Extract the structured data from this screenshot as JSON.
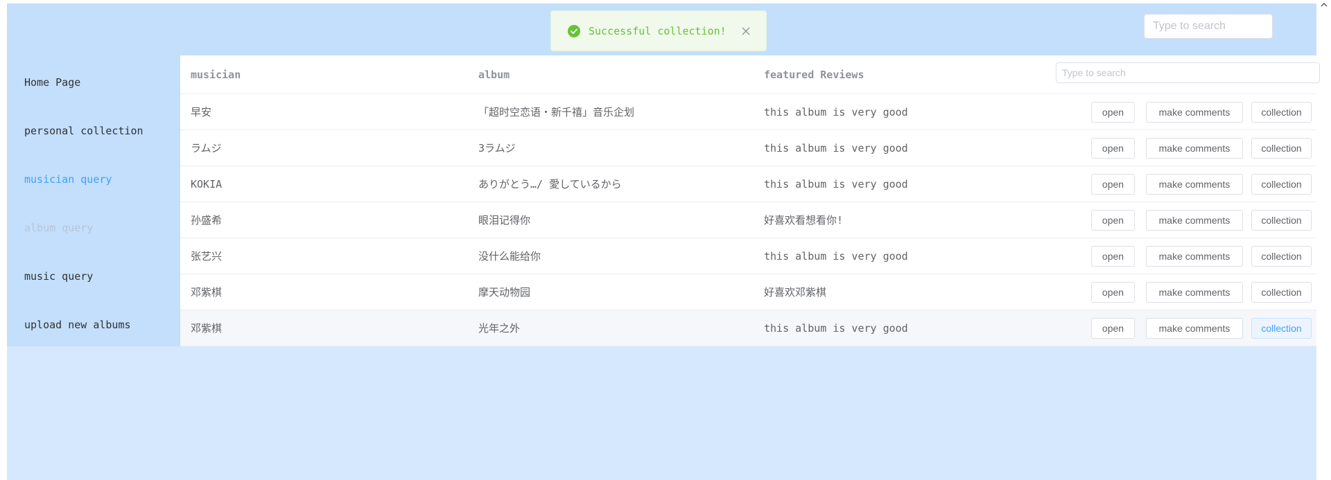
{
  "header": {
    "search_placeholder": "Type to search"
  },
  "toast": {
    "message": "Successful collection!",
    "success_color": "#67c23a",
    "icon": "check-circle-icon",
    "close_icon": "close-icon"
  },
  "sidebar": {
    "items": [
      {
        "label": "Home Page"
      },
      {
        "label": "personal collection"
      },
      {
        "label": "musician query",
        "state": "active"
      },
      {
        "label": "album query",
        "state": "disabled"
      },
      {
        "label": "music query"
      },
      {
        "label": "upload new albums"
      }
    ]
  },
  "table": {
    "columns": {
      "musician": "musician",
      "album": "album",
      "reviews": "featured Reviews"
    },
    "search_placeholder": "Type to search",
    "rows": [
      {
        "musician": "早安",
        "album": "「超时空恋语・新千禧」音乐企划",
        "review": "this album is very good"
      },
      {
        "musician": "ラムジ",
        "album": "3ラムジ",
        "review": "this album is very good"
      },
      {
        "musician": "KOKIA",
        "album": "ありがとう…/ 愛しているから",
        "review": "this album is very good"
      },
      {
        "musician": "孙盛希",
        "album": "眼泪记得你",
        "review": "好喜欢看想看你!"
      },
      {
        "musician": "张艺兴",
        "album": "没什么能给你",
        "review": "this album is very good"
      },
      {
        "musician": "邓紫棋",
        "album": "摩天动物园",
        "review": "好喜欢邓紫棋"
      },
      {
        "musician": "邓紫棋",
        "album": "光年之外",
        "review": "this album is very good"
      }
    ],
    "actions": {
      "open": "open",
      "comments": "make comments",
      "collection": "collection"
    }
  },
  "colors": {
    "accent": "#409eff",
    "nav_bg": "#c4dffc",
    "page_bg": "#d6e8fd"
  }
}
